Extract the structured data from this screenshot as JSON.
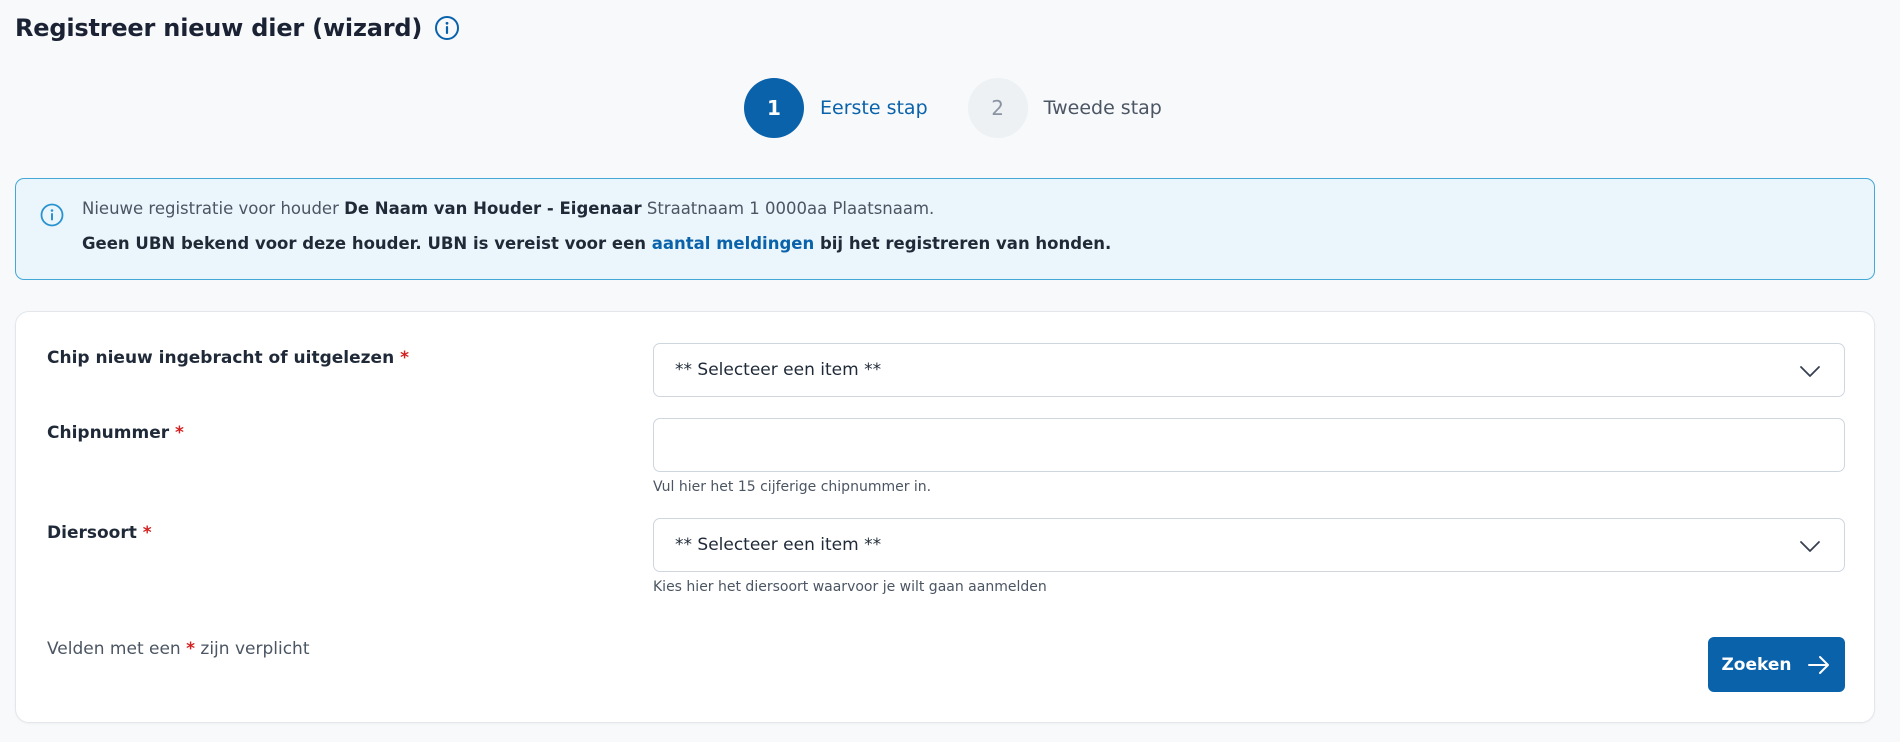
{
  "page": {
    "title": "Registreer nieuw dier (wizard)",
    "title_icon": "info-icon"
  },
  "stepper": {
    "steps": [
      {
        "number": "1",
        "label": "Eerste stap",
        "state": "active"
      },
      {
        "number": "2",
        "label": "Tweede stap",
        "state": "inactive"
      }
    ]
  },
  "banner": {
    "icon": "info-icon",
    "line1_prefix": "Nieuwe registratie voor houder ",
    "holder_name": "De Naam van Houder - Eigenaar",
    "address": " Straatnaam 1 0000aa Plaatsnaam.",
    "line2_prefix": "Geen UBN bekend voor deze houder. UBN is vereist voor een ",
    "link_text": "aantal meldingen",
    "line2_suffix": " bij het registreren van honden."
  },
  "form": {
    "fields": [
      {
        "label": "Chip nieuw ingebracht of uitgelezen",
        "required_mark": "*",
        "type": "select",
        "value": "** Selecteer een item **",
        "hint": ""
      },
      {
        "label": "Chipnummer",
        "required_mark": "*",
        "type": "text",
        "value": "",
        "hint": "Vul hier het 15 cijferige chipnummer in."
      },
      {
        "label": "Diersoort",
        "required_mark": "*",
        "type": "select",
        "value": "** Selecteer een item **",
        "hint": "Kies hier het diersoort waarvoor je wilt gaan aanmelden"
      }
    ],
    "required_note_prefix": "Velden met een ",
    "required_note_mark": "*",
    "required_note_suffix": " zijn verplicht",
    "submit_label": "Zoeken",
    "submit_icon": "arrow-right-icon"
  },
  "colors": {
    "primary": "#0a62ab",
    "banner_bg": "#eaf6fc",
    "banner_border": "#44a8d6",
    "required": "#d42020"
  }
}
